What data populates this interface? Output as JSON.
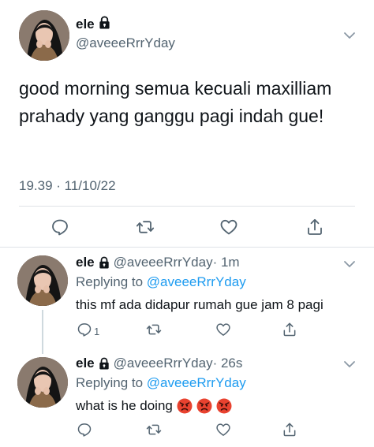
{
  "main_tweet": {
    "display_name": "ele",
    "handle": "@aveeeRrrYday",
    "text": "good morning semua kecuali maxilliam prahady yang ganggu pagi indah gue!",
    "timestamp": "19.39 · 11/10/22",
    "icons": [
      "lock-icon",
      "chevron-down-icon",
      "reply-icon",
      "retweet-icon",
      "like-icon",
      "share-icon"
    ]
  },
  "replies": [
    {
      "display_name": "ele",
      "handle": "@aveeeRrrYday",
      "time_ago": "· 1m",
      "replying_prefix": "Replying to ",
      "replying_to": "@aveeeRrrYday",
      "text": "this mf ada didapur rumah gue jam 8 pagi",
      "reply_count": "1"
    },
    {
      "display_name": "ele",
      "handle": "@aveeeRrrYday",
      "time_ago": "· 26s",
      "replying_prefix": "Replying to ",
      "replying_to": "@aveeeRrrYday",
      "text": "what is he doing",
      "emojis": [
        "angry-face",
        "angry-face",
        "angry-face"
      ]
    }
  ],
  "colors": {
    "text": "#0f1419",
    "secondary": "#536471",
    "link": "#1d9bf0",
    "divider": "#dfe3e7",
    "angry_emoji": "#e8422f"
  }
}
